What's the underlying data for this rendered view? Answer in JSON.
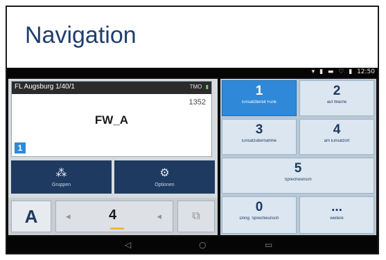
{
  "slide": {
    "title": "Navigation"
  },
  "statusbar": {
    "wifi": "▾",
    "signal": "▮",
    "mail": "▬",
    "alarm": "♡",
    "battery": "▮",
    "time": "12:50"
  },
  "group_card": {
    "title": "FL Augsburg 1/40/1",
    "network": "TMO",
    "number": "1352",
    "name": "FW_A",
    "badge": "1"
  },
  "actions": {
    "groups_icon": "⁂",
    "groups_label": "Gruppen",
    "options_icon": "⚙",
    "options_label": "Optionen"
  },
  "bottom": {
    "brand": "A",
    "volume_down": "◂",
    "volume_value": "4",
    "volume_level": 0.4,
    "volume_up": "◂",
    "messages_icon": "⧉"
  },
  "keypad": {
    "keys": [
      {
        "num": "1",
        "label": "Einsatzbereit Funk",
        "active": true
      },
      {
        "num": "2",
        "label": "auf Wache",
        "active": false
      },
      {
        "num": "3",
        "label": "Einsatzübernahme",
        "active": false
      },
      {
        "num": "4",
        "label": "am Einsatzort",
        "active": false
      },
      {
        "num": "5",
        "label": "Sprechwunsch",
        "active": false
      },
      {
        "num": "0",
        "label": "Dring. Sprechwunsch",
        "active": false
      },
      {
        "num": "...",
        "label": "weitere",
        "active": false
      }
    ]
  },
  "navbar": {
    "back": "◁",
    "home": "○",
    "recent": "▭"
  }
}
